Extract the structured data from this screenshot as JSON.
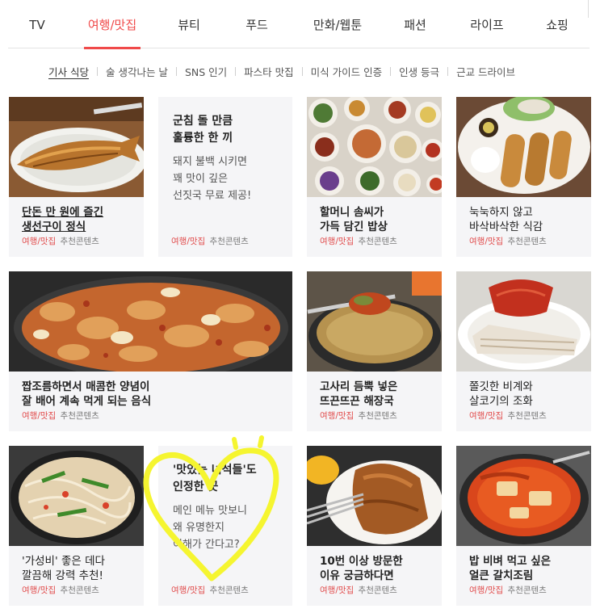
{
  "nav": {
    "tabs": [
      {
        "label": "TV",
        "active": false
      },
      {
        "label": "여행/맛집",
        "active": true
      },
      {
        "label": "뷰티",
        "active": false
      },
      {
        "label": "푸드",
        "active": false
      },
      {
        "label": "만화/웹툰",
        "active": false
      },
      {
        "label": "패션",
        "active": false
      },
      {
        "label": "라이프",
        "active": false
      },
      {
        "label": "쇼핑",
        "active": false
      }
    ],
    "accent_color": "#f04a4a"
  },
  "subnav": {
    "items": [
      {
        "label": "기사 식당",
        "active": true
      },
      {
        "label": "술 생각나는 날",
        "active": false
      },
      {
        "label": "SNS 인기",
        "active": false
      },
      {
        "label": "파스타 맛집",
        "active": false
      },
      {
        "label": "미식 가이드 인증",
        "active": false
      },
      {
        "label": "인생 등극",
        "active": false
      },
      {
        "label": "근교 드라이브",
        "active": false
      }
    ]
  },
  "cards": [
    {
      "title_lines": [
        "단돈 만 원에 즐긴",
        "생선구이 정식"
      ],
      "category": "여행/맛집",
      "type": "추천콘텐츠",
      "image": "grilled-fish-photo"
    },
    {
      "heading_lines": [
        "군침 돌 만큼",
        "훌륭한 한 끼"
      ],
      "body_lines": [
        "돼지 불백 시키면",
        "꽤 맛이 깊은",
        "선짓국 무료 제공!"
      ],
      "category": "여행/맛집",
      "type": "추천콘텐츠"
    },
    {
      "title_lines": [
        "할머니 솜씨가",
        "가득 담긴 밥상"
      ],
      "category": "여행/맛집",
      "type": "추천콘텐츠",
      "image": "korean-side-dishes-photo"
    },
    {
      "title_lines": [
        "눅눅하지 않고",
        "바삭바삭한 식감"
      ],
      "category": "여행/맛집",
      "type": "추천콘텐츠",
      "image": "pork-cutlet-photo"
    },
    {
      "title_lines": [
        "짭조름하면서 매콤한 양념이",
        "잘 배어 계속 먹게 되는 음식"
      ],
      "category": "여행/맛집",
      "type": "추천콘텐츠",
      "image": "spicy-stir-fried-pork-photo"
    },
    {
      "title_lines": [
        "고사리 듬뿍 넣은",
        "뜨끈뜨끈 해장국"
      ],
      "category": "여행/맛집",
      "type": "추천콘텐츠",
      "image": "hangover-soup-photo"
    },
    {
      "title_lines": [
        "쫄깃한 비계와",
        "살코기의 조화"
      ],
      "category": "여행/맛집",
      "type": "추천콘텐츠",
      "image": "boiled-pork-photo"
    },
    {
      "title_lines": [
        "'가성비' 좋은 데다",
        "깔끔해 강력 추천!"
      ],
      "category": "여행/맛집",
      "type": "추천콘텐츠",
      "image": "stir-fried-noodle-pan-photo"
    },
    {
      "heading_lines": [
        "'맛있는 녀석들'도",
        "인정한 곳"
      ],
      "body_lines": [
        "메인 메뉴 맛보니",
        "왜 유명한지",
        "이해가 간다고?"
      ],
      "category": "여행/맛집",
      "type": "추천콘텐츠"
    },
    {
      "title_lines": [
        "10번 이상 방문한",
        "이유 궁금하다면"
      ],
      "category": "여행/맛집",
      "type": "추천콘텐츠",
      "image": "fried-cutlet-photo"
    },
    {
      "title_lines": [
        "밥 비벼 먹고 싶은",
        "얼큰 갈치조림"
      ],
      "category": "여행/맛집",
      "type": "추천콘텐츠",
      "image": "braised-cutlassfish-photo"
    }
  ],
  "annotation": {
    "shape": "heart-scribble",
    "color": "#f5f530"
  }
}
